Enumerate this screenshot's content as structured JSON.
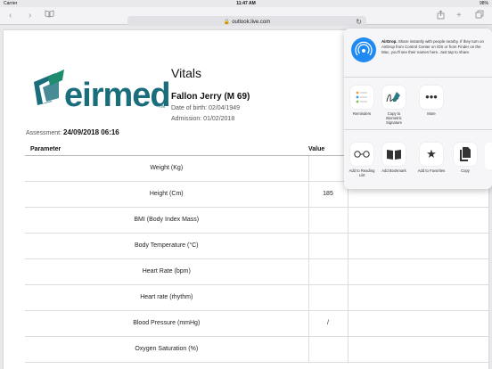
{
  "status_bar": {
    "carrier": "Carrier",
    "time": "11:47 AM",
    "battery": "98%"
  },
  "browser": {
    "url": "outlook.live.com",
    "icons": [
      "back-icon",
      "forward-icon",
      "bookmarks-icon",
      "lock-icon",
      "reload-icon",
      "share-icon",
      "new-tab-icon",
      "tabs-icon"
    ]
  },
  "document": {
    "logo_text": "eirmed",
    "logo_tm": "TM",
    "title": "Vitals",
    "patient_name": "Fallon Jerry (M 69)",
    "dob": "Date of birth: 02/04/1949",
    "admission": "Admission: 01/02/2018",
    "assessment_label": "Assessment:",
    "assessment_value": "24/09/2018 06:16",
    "table": {
      "headers": [
        "Parameter",
        "Value"
      ],
      "rows": [
        {
          "param": "Weight (Kg)",
          "value": ""
        },
        {
          "param": "Height (Cm)",
          "value": "185"
        },
        {
          "param": "BMI (Body Index Mass)",
          "value": ""
        },
        {
          "param": "Body Temperature (°C)",
          "value": ""
        },
        {
          "param": "Heart Rate (bpm)",
          "value": ""
        },
        {
          "param": "Heart rate (rhythm)",
          "value": ""
        },
        {
          "param": "Blood Pressure (mmHg)",
          "value": "/"
        },
        {
          "param": "Oxygen Saturation (%)",
          "value": ""
        }
      ]
    }
  },
  "share_sheet": {
    "airdrop_title": "AirDrop.",
    "airdrop_text": "Share instantly with people nearby. If they turn on AirDrop from Control Center on iOS or from Finder on the Mac, you'll see their names here. Just tap to share.",
    "row1": [
      {
        "label": "Reminders",
        "icon": "reminders-icon"
      },
      {
        "label": "Copy to Biometric Signature",
        "icon": "signature-icon"
      },
      {
        "label": "More",
        "icon": "more-icon"
      }
    ],
    "row2": [
      {
        "label": "Add to Reading List",
        "icon": "glasses-icon"
      },
      {
        "label": "Add Bookmark",
        "icon": "book-icon"
      },
      {
        "label": "Add to Favorites",
        "icon": "star-icon"
      },
      {
        "label": "Copy",
        "icon": "copy-icon"
      }
    ]
  },
  "colors": {
    "brand": "#1a6e7c",
    "airdrop": "#1f8af2"
  }
}
